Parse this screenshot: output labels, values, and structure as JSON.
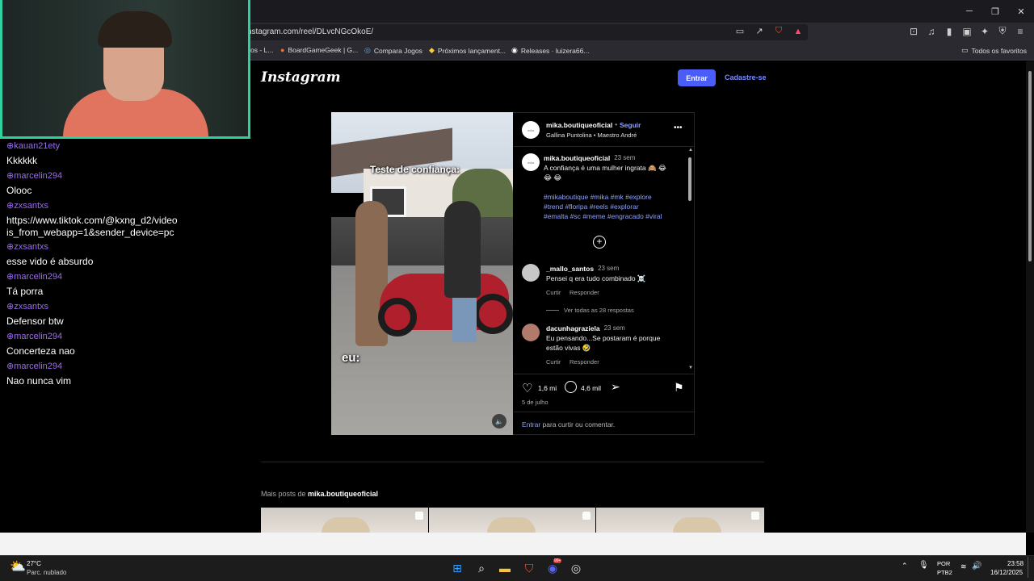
{
  "browser": {
    "url": "nstagram.com/reel/DLvcNGcOkoE/",
    "bookmarks": [
      {
        "label": "os - L...",
        "icon": ""
      },
      {
        "label": "BoardGameGeek | G...",
        "icon": "●"
      },
      {
        "label": "Compara Jogos",
        "icon": "◎"
      },
      {
        "label": "Próximos lançament...",
        "icon": "◆"
      },
      {
        "label": "Releases · luizera66...",
        "icon": "◉"
      }
    ],
    "all_bookmarks": "Todos os favoritos"
  },
  "instagram": {
    "logo": "Instagram",
    "login_button": "Entrar",
    "signup_link": "Cadastre-se",
    "video": {
      "caption_top": "Teste de confiança:",
      "caption_bottom": "eu:"
    },
    "post": {
      "author": "mika.boutiqueoficial",
      "separator": "•",
      "follow": "Seguir",
      "audio": "Gallina Puntolina • Maestro André",
      "avatar_text": "mika",
      "caption_author": "mika.boutiqueoficial",
      "caption_time": "23 sem",
      "caption_text": "A confiança é uma mulher ingrata 🙈 😂",
      "caption_emoji": "😂 😂",
      "hashtags": [
        "#mikaboutique #mika #mk #explore",
        "#trend #floripa #reels #explorar",
        "#emalta #sc #meme #engracado #viral"
      ],
      "comments": [
        {
          "user": "_mallo_santos",
          "time": "23 sem",
          "text": "Pensei q era tudo combinado ☠️",
          "like": "Curtir",
          "reply": "Responder",
          "view_replies": "Ver todas as 28 respostas"
        },
        {
          "user": "dacunhagraziela",
          "time": "23 sem",
          "text": "Eu pensando...Se postaram é porque",
          "text2": "estão vivas 🤣",
          "like": "Curtir",
          "reply": "Responder"
        }
      ],
      "likes": "1,6 mi",
      "comments_count": "4,6 mil",
      "date": "5 de julho",
      "login_prompt_link": "Entrar",
      "login_prompt_text": "para curtir ou comentar."
    },
    "more_posts_prefix": "Mais posts de",
    "more_posts_author": "mika.boutiqueoficial"
  },
  "chat": [
    {
      "user": "kauan21ety",
      "msg": "Kkkkkk"
    },
    {
      "user": "marcelin294",
      "msg": "Olooc"
    },
    {
      "user": "zxsantxs",
      "msg": "https://www.tiktok.com/@kxng_d2/video",
      "msg2": "is_from_webapp=1&sender_device=pc"
    },
    {
      "user": "zxsantxs",
      "msg": "esse vido é absurdo"
    },
    {
      "user": "marcelin294",
      "msg": "Tá porra"
    },
    {
      "user": "zxsantxs",
      "msg": "Defensor btw"
    },
    {
      "user": "marcelin294",
      "msg": "Concerteza nao"
    },
    {
      "user": "marcelin294",
      "msg": "Nao nunca vim"
    }
  ],
  "taskbar": {
    "weather_temp": "27°C",
    "weather_desc": "Parc. nublado",
    "lang_top": "POR",
    "lang_bottom": "PTB2",
    "time": "23:58",
    "date": "16/12/2025",
    "discord_badge": "99+"
  }
}
